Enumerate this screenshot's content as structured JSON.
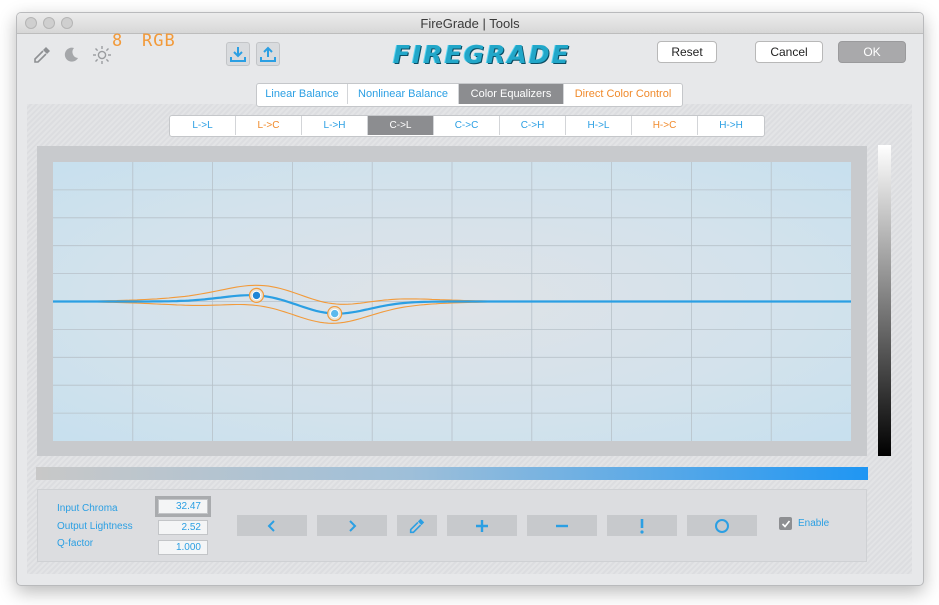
{
  "window": {
    "title": "FireGrade | Tools"
  },
  "toolbar": {
    "icons": [
      "eyedropper-icon",
      "moon-icon",
      "sun-icon",
      "download-icon",
      "upload-icon"
    ],
    "bit_depth": "8",
    "color_mode": "RGB",
    "logo_text": "FIREGRADE",
    "reset_label": "Reset",
    "cancel_label": "Cancel",
    "ok_label": "OK"
  },
  "tabs": [
    {
      "label": "Linear Balance",
      "selected": false
    },
    {
      "label": "Nonlinear Balance",
      "selected": false
    },
    {
      "label": "Color Equalizers",
      "selected": true
    },
    {
      "label": "Direct Color Control",
      "selected": false
    }
  ],
  "subtabs": [
    {
      "label": "L->L",
      "selected": false
    },
    {
      "label": "L->C",
      "selected": false
    },
    {
      "label": "L->H",
      "selected": false
    },
    {
      "label": "C->L",
      "selected": true
    },
    {
      "label": "C->C",
      "selected": false
    },
    {
      "label": "C->H",
      "selected": false
    },
    {
      "label": "H->L",
      "selected": false
    },
    {
      "label": "H->C",
      "selected": false
    },
    {
      "label": "H->H",
      "selected": false
    }
  ],
  "curve": {
    "control_points": [
      {
        "input": 0.255,
        "output": 0.525,
        "active": true
      },
      {
        "input": 0.353,
        "output": 0.455,
        "active": false
      }
    ],
    "colors": {
      "curve": "#2b9fe3",
      "bounds": "#f29a3a",
      "grid": "#b7c1c9"
    }
  },
  "params": {
    "input_chroma_label": "Input Chroma",
    "input_chroma_value": "32.47",
    "output_lightness_label": "Output Lightness",
    "output_lightness_value": "2.52",
    "qfactor_label": "Q-factor",
    "qfactor_value": "1.000"
  },
  "tools": [
    "chevron-left-icon",
    "chevron-right-icon",
    "eyedropper-icon",
    "plus-icon",
    "minus-icon",
    "exclamation-icon",
    "circle-icon"
  ],
  "enable": {
    "label": "Enable",
    "checked": true
  },
  "colors": {
    "accent": "#2b9fe3",
    "orange": "#f29a3a",
    "selected_tab": "#8c8d90"
  }
}
